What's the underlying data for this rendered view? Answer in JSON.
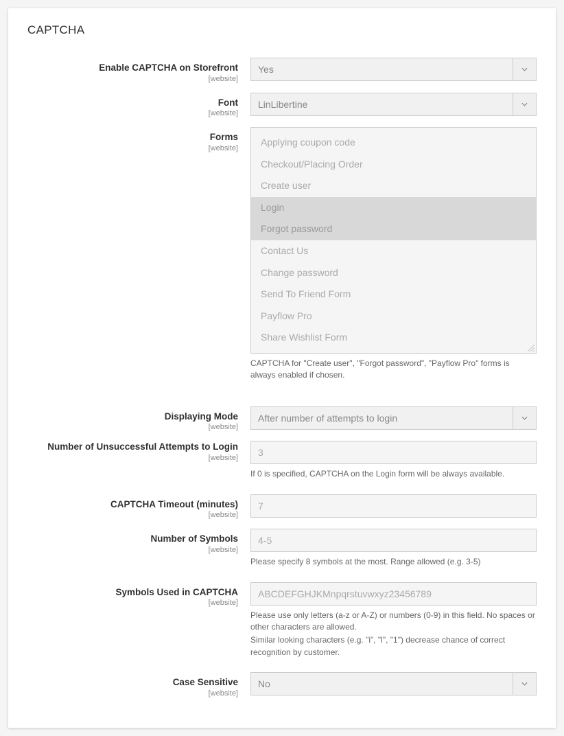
{
  "section": {
    "title": "CAPTCHA"
  },
  "scope_label": "[website]",
  "fields": {
    "enable": {
      "label": "Enable CAPTCHA on Storefront",
      "value": "Yes"
    },
    "font": {
      "label": "Font",
      "value": "LinLibertine"
    },
    "forms": {
      "label": "Forms",
      "options": [
        {
          "label": "Applying coupon code",
          "selected": false
        },
        {
          "label": "Checkout/Placing Order",
          "selected": false
        },
        {
          "label": "Create user",
          "selected": false
        },
        {
          "label": "Login",
          "selected": true
        },
        {
          "label": "Forgot password",
          "selected": true
        },
        {
          "label": "Contact Us",
          "selected": false
        },
        {
          "label": "Change password",
          "selected": false
        },
        {
          "label": "Send To Friend Form",
          "selected": false
        },
        {
          "label": "Payflow Pro",
          "selected": false
        },
        {
          "label": "Share Wishlist Form",
          "selected": false
        }
      ],
      "note": "CAPTCHA for \"Create user\", \"Forgot password\", \"Payflow Pro\" forms is always enabled if chosen."
    },
    "mode": {
      "label": "Displaying Mode",
      "value": "After number of attempts to login"
    },
    "attempts": {
      "label": "Number of Unsuccessful Attempts to Login",
      "value": "3",
      "note": "If 0 is specified, CAPTCHA on the Login form will be always available."
    },
    "timeout": {
      "label": "CAPTCHA Timeout (minutes)",
      "value": "7"
    },
    "symbols_count": {
      "label": "Number of Symbols",
      "value": "4-5",
      "note": "Please specify 8 symbols at the most. Range allowed (e.g. 3-5)"
    },
    "symbols_used": {
      "label": "Symbols Used in CAPTCHA",
      "value": "ABCDEFGHJKMnpqrstuvwxyz23456789",
      "note1": "Please use only letters (a-z or A-Z) or numbers (0-9) in this field. No spaces or other characters are allowed.",
      "note2": "Similar looking characters (e.g. \"i\", \"l\", \"1\") decrease chance of correct recognition by customer."
    },
    "case_sensitive": {
      "label": "Case Sensitive",
      "value": "No"
    }
  }
}
